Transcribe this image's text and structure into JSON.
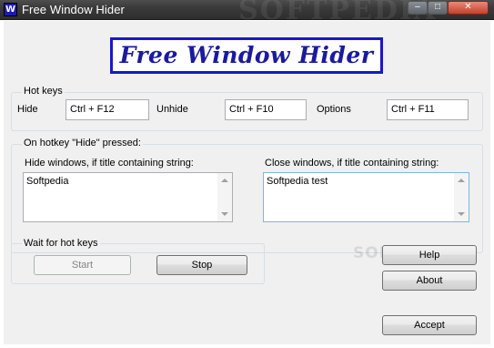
{
  "window": {
    "title": "Free Window Hider",
    "minimize": "–",
    "maximize": "□",
    "close": "✕"
  },
  "watermark": "SOFTPEDIA",
  "logo": {
    "text": "Free Window Hider"
  },
  "hotkeys": {
    "group_label": "Hot keys",
    "hide_label": "Hide",
    "hide_value": "Ctrl + F12",
    "unhide_label": "Unhide",
    "unhide_value": "Ctrl + F10",
    "options_label": "Options",
    "options_value": "Ctrl + F11"
  },
  "on_hide": {
    "group_label": "On hotkey \"Hide\" pressed:",
    "hide_windows_label": "Hide windows, if title containing string:",
    "hide_windows_value": "Softpedia",
    "close_windows_label": "Close windows, if title containing string:",
    "close_windows_value": "Softpedia test"
  },
  "wait": {
    "group_label": "Wait for hot keys",
    "start_label": "Start",
    "stop_label": "Stop"
  },
  "buttons": {
    "help": "Help",
    "about": "About",
    "accept": "Accept"
  }
}
